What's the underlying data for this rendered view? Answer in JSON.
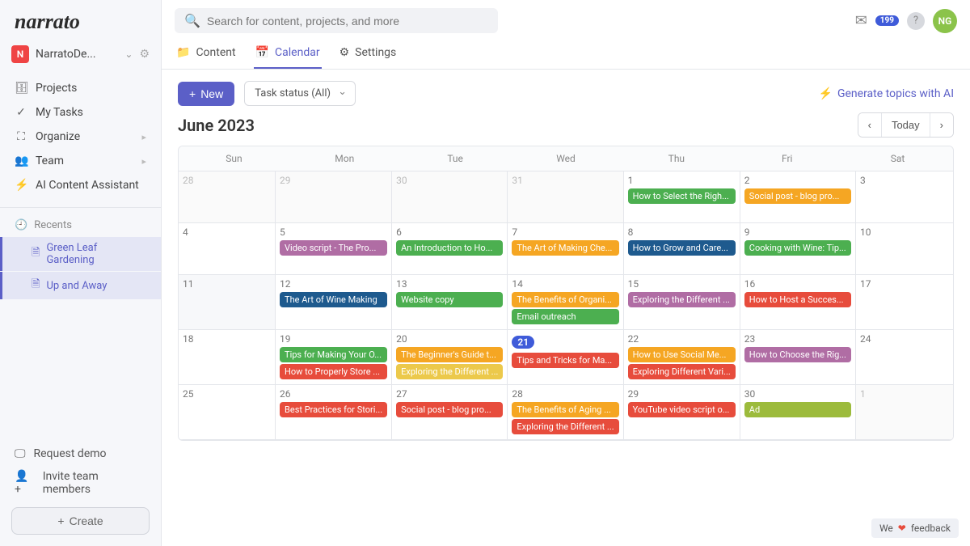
{
  "logo": "narrato",
  "workspace": {
    "badge": "N",
    "name": "NarratoDe..."
  },
  "nav": [
    {
      "icon": "briefcase-icon",
      "glyph": "🗄",
      "label": "Projects"
    },
    {
      "icon": "check-icon",
      "glyph": "✓",
      "label": "My Tasks"
    },
    {
      "icon": "layers-icon",
      "glyph": "⛶",
      "label": "Organize",
      "chev": true
    },
    {
      "icon": "team-icon",
      "glyph": "👥",
      "label": "Team",
      "chev": true
    },
    {
      "icon": "bolt-icon",
      "glyph": "⚡",
      "label": "AI Content Assistant"
    }
  ],
  "recents": {
    "header": "Recents",
    "items": [
      "Green Leaf Gardening",
      "Up and Away"
    ]
  },
  "footer": {
    "demo": "Request demo",
    "invite": "Invite team members",
    "create": "Create"
  },
  "search_placeholder": "Search for content, projects, and more",
  "notif_count": "199",
  "avatar": "NG",
  "tabs": [
    {
      "icon": "📁",
      "label": "Content",
      "active": false
    },
    {
      "icon": "📅",
      "label": "Calendar",
      "active": true
    },
    {
      "icon": "⚙",
      "label": "Settings",
      "active": false
    }
  ],
  "new_label": "New",
  "status_label": "Task status (All)",
  "ai_generate": "Generate topics with AI",
  "month": "June 2023",
  "today_label": "Today",
  "dayheaders": [
    "Sun",
    "Mon",
    "Tue",
    "Wed",
    "Thu",
    "Fri",
    "Sat"
  ],
  "weeks": [
    [
      {
        "num": "28",
        "muted": true
      },
      {
        "num": "29",
        "muted": true
      },
      {
        "num": "30",
        "muted": true
      },
      {
        "num": "31",
        "muted": true
      },
      {
        "num": "1",
        "events": [
          {
            "t": "How to Select the Righ...",
            "c": "c-green"
          }
        ]
      },
      {
        "num": "2",
        "events": [
          {
            "t": "Social post - blog pro...",
            "c": "c-orange"
          }
        ]
      },
      {
        "num": "3"
      }
    ],
    [
      {
        "num": "4"
      },
      {
        "num": "5",
        "events": [
          {
            "t": "Video script - The Pro...",
            "c": "c-purple"
          }
        ]
      },
      {
        "num": "6",
        "events": [
          {
            "t": "An Introduction to Ho...",
            "c": "c-green"
          }
        ]
      },
      {
        "num": "7",
        "events": [
          {
            "t": "The Art of Making Che...",
            "c": "c-orange"
          }
        ]
      },
      {
        "num": "8",
        "events": [
          {
            "t": "How to Grow and Care...",
            "c": "c-blue"
          }
        ]
      },
      {
        "num": "9",
        "events": [
          {
            "t": "Cooking with Wine: Tip...",
            "c": "c-green"
          }
        ]
      },
      {
        "num": "10"
      }
    ],
    [
      {
        "num": "11",
        "gray": true
      },
      {
        "num": "12",
        "events": [
          {
            "t": "The Art of Wine Making",
            "c": "c-blue"
          }
        ]
      },
      {
        "num": "13",
        "events": [
          {
            "t": "Website copy",
            "c": "c-green"
          }
        ]
      },
      {
        "num": "14",
        "events": [
          {
            "t": "The Benefits of Organi...",
            "c": "c-orange"
          },
          {
            "t": "Email outreach",
            "c": "c-green"
          }
        ]
      },
      {
        "num": "15",
        "events": [
          {
            "t": "Exploring the Different ...",
            "c": "c-purple"
          }
        ]
      },
      {
        "num": "16",
        "events": [
          {
            "t": "How to Host a Succes...",
            "c": "c-red"
          }
        ]
      },
      {
        "num": "17"
      }
    ],
    [
      {
        "num": "18"
      },
      {
        "num": "19",
        "events": [
          {
            "t": "Tips for Making Your O...",
            "c": "c-green"
          },
          {
            "t": "How to Properly Store ...",
            "c": "c-red"
          }
        ]
      },
      {
        "num": "20",
        "events": [
          {
            "t": "The Beginner's Guide t...",
            "c": "c-orange"
          },
          {
            "t": "Exploring the Different ...",
            "c": "c-yellow"
          }
        ]
      },
      {
        "num": "21",
        "today": true,
        "events": [
          {
            "t": "Tips and Tricks for Ma...",
            "c": "c-red"
          }
        ]
      },
      {
        "num": "22",
        "events": [
          {
            "t": "How to Use Social Me...",
            "c": "c-orange"
          },
          {
            "t": "Exploring Different Vari...",
            "c": "c-red"
          }
        ]
      },
      {
        "num": "23",
        "events": [
          {
            "t": "How to Choose the Rig...",
            "c": "c-purple"
          }
        ]
      },
      {
        "num": "24"
      }
    ],
    [
      {
        "num": "25"
      },
      {
        "num": "26",
        "events": [
          {
            "t": "Best Practices for Stori...",
            "c": "c-red"
          }
        ]
      },
      {
        "num": "27",
        "events": [
          {
            "t": "Social post - blog pro...",
            "c": "c-red"
          }
        ]
      },
      {
        "num": "28",
        "events": [
          {
            "t": "The Benefits of Aging ...",
            "c": "c-orange"
          },
          {
            "t": "Exploring the Different ...",
            "c": "c-red"
          }
        ]
      },
      {
        "num": "29",
        "events": [
          {
            "t": "YouTube video script o...",
            "c": "c-red"
          }
        ]
      },
      {
        "num": "30",
        "events": [
          {
            "t": "Ad",
            "c": "c-olive"
          }
        ]
      },
      {
        "num": "1",
        "muted": true
      }
    ]
  ],
  "feedback": {
    "we": "We",
    "txt": "feedback"
  }
}
